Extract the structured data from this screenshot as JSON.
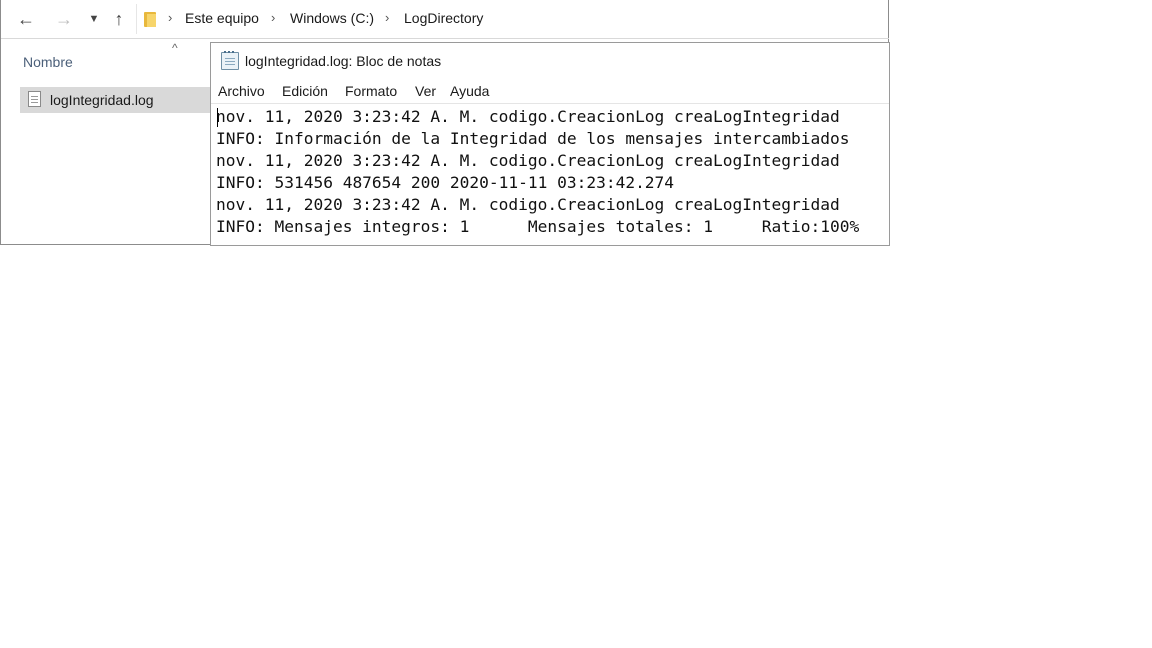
{
  "explorer": {
    "breadcrumb": [
      "Este equipo",
      "Windows (C:)",
      "LogDirectory"
    ],
    "column_header": "Nombre",
    "files": [
      {
        "name": "logIntegridad.log",
        "selected": true
      }
    ],
    "icons": {
      "back": "arrow-left-icon",
      "forward": "arrow-right-icon",
      "recent": "chevron-down-icon",
      "up": "arrow-up-icon",
      "folder": "folder-icon",
      "file": "text-file-icon",
      "sort": "sort-ascending-icon"
    }
  },
  "notepad": {
    "title": "logIntegridad.log: Bloc de notas",
    "menu": [
      "Archivo",
      "Edición",
      "Formato",
      "Ver",
      "Ayuda"
    ],
    "lines": [
      "nov. 11, 2020 3:23:42 A. M. codigo.CreacionLog creaLogIntegridad",
      "INFO: Información de la Integridad de los mensajes intercambiados",
      "nov. 11, 2020 3:23:42 A. M. codigo.CreacionLog creaLogIntegridad",
      "INFO: 531456 487654 200 2020-11-11 03:23:42.274",
      "nov. 11, 2020 3:23:42 A. M. codigo.CreacionLog creaLogIntegridad",
      "INFO: Mensajes integros: 1      Mensajes totales: 1     Ratio:100%"
    ]
  },
  "colors": {
    "selection": "#d9d9d9",
    "header_text": "#4c607a",
    "folder": "#e8b83c"
  }
}
